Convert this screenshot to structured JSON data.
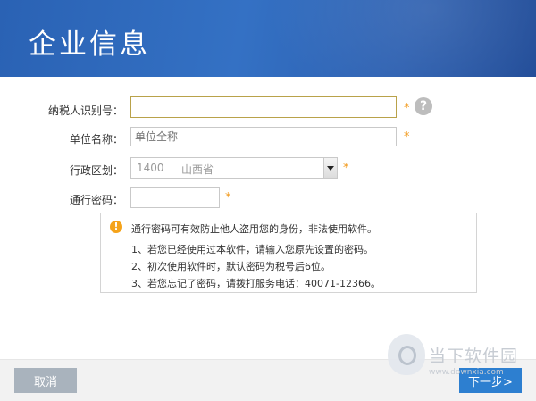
{
  "header": {
    "title": "企业信息"
  },
  "form": {
    "taxpayer_id": {
      "label": "纳税人识别号：",
      "value": "",
      "placeholder": ""
    },
    "company_name": {
      "label": "单位名称：",
      "value": "",
      "placeholder": "单位全称"
    },
    "region": {
      "label": "行政区划：",
      "code": "1400",
      "name": "山西省"
    },
    "pass_code": {
      "label": "通行密码：",
      "value": ""
    },
    "required_mark": "*",
    "help_glyph": "?"
  },
  "notice": {
    "icon": "warning-icon",
    "icon_glyph": "!",
    "title": "通行密码可有效防止他人盗用您的身份，非法使用软件。",
    "items": [
      "1、若您已经使用过本软件，请输入您原先设置的密码。",
      "2、初次使用软件时，默认密码为税号后6位。",
      "3、若您忘记了密码，请拨打服务电话：40071-12366。"
    ]
  },
  "footer": {
    "cancel_label": "取消",
    "next_label": "下一步>"
  },
  "watermark": {
    "text": "当下软件园",
    "url": "www.downxia.com"
  },
  "colors": {
    "header_bg": "#2d66b8",
    "required_star": "#f29a1c",
    "next_button": "#2d7fd0",
    "cancel_button": "#a9b3bd"
  }
}
